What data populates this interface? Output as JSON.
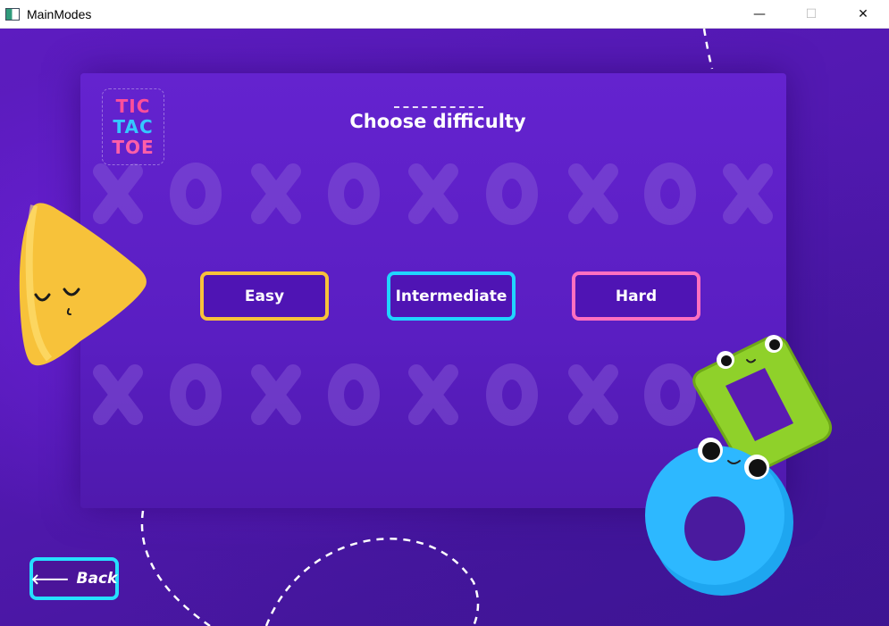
{
  "window": {
    "title": "MainModes",
    "minimize_glyph": "—",
    "maximize_glyph": "☐",
    "close_glyph": "✕"
  },
  "logo": {
    "line1": "TIC",
    "line2": "TAC",
    "line3": "TOE"
  },
  "heading": "Choose difficulty",
  "buttons": {
    "easy": "Easy",
    "intermediate": "Intermediate",
    "hard": "Hard",
    "back": "Back"
  },
  "icons": {
    "back": "arrow-left-icon",
    "app": "app-window-icon"
  },
  "colors": {
    "background": "#5a1bb3",
    "easy_border": "#f8c23a",
    "intermediate_border": "#20d4ff",
    "hard_border": "#ff6fc0",
    "back_border": "#26e0ff",
    "logo_pink": "#ff4f9a",
    "logo_blue": "#35c8ff"
  }
}
